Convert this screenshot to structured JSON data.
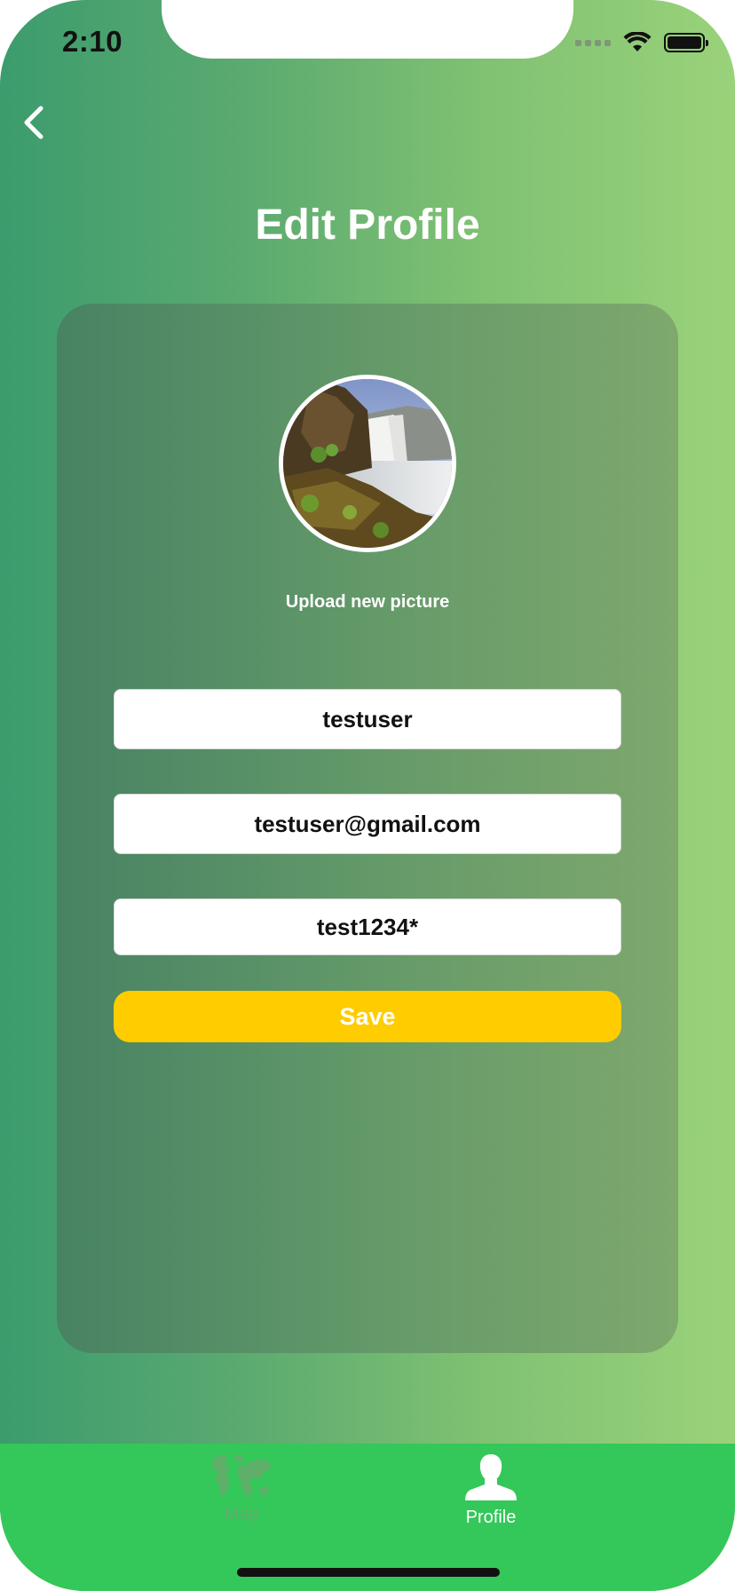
{
  "status_bar": {
    "time": "2:10"
  },
  "header": {
    "title": "Edit Profile",
    "back_icon": "chevron-left-icon"
  },
  "profile_card": {
    "upload_label": "Upload new picture",
    "fields": {
      "username": "testuser",
      "email": "testuser@gmail.com",
      "password": "test1234*"
    },
    "save_label": "Save"
  },
  "tab_bar": {
    "items": [
      {
        "label": "Map",
        "icon": "world-map-icon",
        "active": false
      },
      {
        "label": "Profile",
        "icon": "person-icon",
        "active": true
      }
    ]
  },
  "colors": {
    "accent_button": "#ffcc00",
    "tab_bar": "#34c759",
    "gradient_start": "#3c9c6d",
    "gradient_end": "#9ad27a"
  }
}
